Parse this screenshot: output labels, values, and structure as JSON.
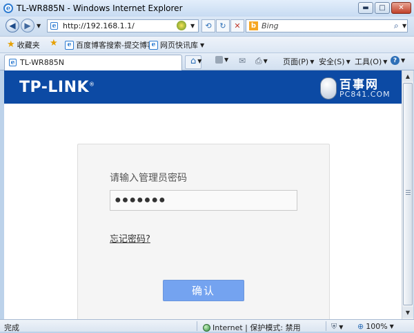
{
  "window": {
    "title": "TL-WR885N - Windows Internet Explorer",
    "buttons": {
      "minimize": "▬",
      "maximize": "□",
      "close": "✕"
    }
  },
  "address_bar": {
    "url": "http://192.168.1.1/",
    "search_placeholder": "Bing",
    "search_engine_badge": "b"
  },
  "favorites_bar": {
    "favorites_label": "收藏夹",
    "items": [
      "百度博客搜索-提交博客",
      "网页快讯库"
    ]
  },
  "tab": {
    "label": "TL-WR885N"
  },
  "command_bar": {
    "page_menu": "页面(P)",
    "safety_menu": "安全(S)",
    "tools_menu": "工具(O)",
    "help_icon": "?"
  },
  "page": {
    "logo": {
      "text": "TP-LINK",
      "mark": "®"
    },
    "watermark": {
      "title": "百事网",
      "site": "PC841.COM"
    },
    "login": {
      "prompt": "请输入管理员密码",
      "password_value": "●●●●●●●",
      "forgot_link": "忘记密码?",
      "confirm_button": "确认"
    }
  },
  "status_bar": {
    "status": "完成",
    "zone": "Internet | 保护模式: 禁用",
    "zoom": "100%"
  },
  "colors": {
    "header_blue": "#0c4aa4",
    "button_blue": "#74a3f0",
    "card_bg": "#f5f5f5"
  }
}
